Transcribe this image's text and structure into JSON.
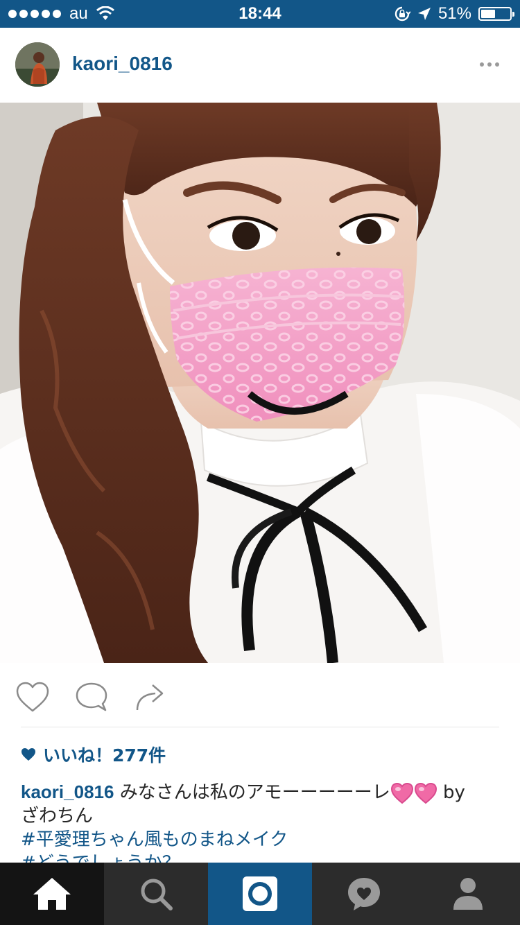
{
  "status_bar": {
    "carrier": "au",
    "time": "18:44",
    "battery": "51%",
    "battery_level": 0.51
  },
  "post": {
    "username": "kaori_0816",
    "likes": "いいね！277件",
    "caption": {
      "username": "kaori_0816",
      "text": "みなさんは私のアモーーーーーレ",
      "suffix": "by",
      "line2": "ざわちん",
      "hashtag1": "#平愛理ちゃん風ものまねメイク",
      "hashtag2": "#どうでしょうか？"
    }
  },
  "icons": {
    "more": "more-dots-icon",
    "like": "heart-outline-icon",
    "comment": "comment-icon",
    "share": "share-icon"
  },
  "colors": {
    "brand": "#125688",
    "heart_pink": "#f06aa6"
  },
  "tabbar": {
    "tabs": [
      "home",
      "search",
      "camera",
      "activity",
      "profile"
    ],
    "active": "home"
  }
}
